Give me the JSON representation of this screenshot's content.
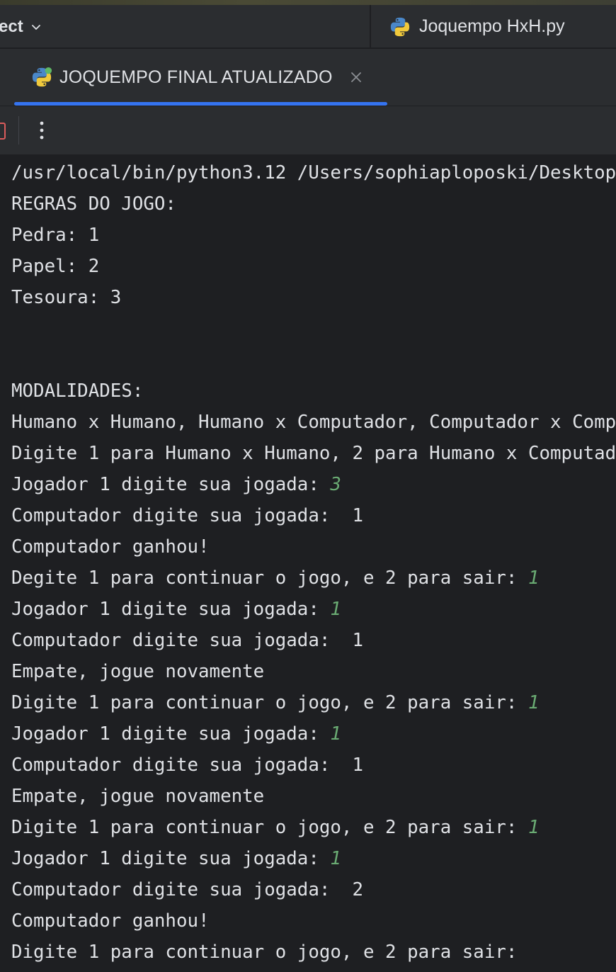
{
  "header": {
    "project_label": "ect",
    "editor_tab": {
      "label": "Joquempo HxH.py",
      "icon": "python-icon"
    }
  },
  "run_panel": {
    "tab": {
      "label": "JOQUEMPO FINAL ATUALIZADO",
      "icon": "python-icon"
    }
  },
  "toolbar": {
    "stop_icon": "stop-icon",
    "more_icon": "more-vertical-icon"
  },
  "console": {
    "input_color": "#6aab73",
    "lines": [
      {
        "text": "/usr/local/bin/python3.12 /Users/sophiaploposki/Desktop",
        "input": ""
      },
      {
        "text": "REGRAS DO JOGO:",
        "input": ""
      },
      {
        "text": "Pedra: 1",
        "input": ""
      },
      {
        "text": "Papel: 2",
        "input": ""
      },
      {
        "text": "Tesoura: 3",
        "input": ""
      },
      {
        "text": "",
        "input": ""
      },
      {
        "text": "",
        "input": ""
      },
      {
        "text": "MODALIDADES:",
        "input": ""
      },
      {
        "text": "Humano x Humano, Humano x Computador, Computador x Comp",
        "input": ""
      },
      {
        "text": "Digite 1 para Humano x Humano, 2 para Humano x Computad",
        "input": ""
      },
      {
        "text": "Jogador 1 digite sua jogada: ",
        "input": "3"
      },
      {
        "text": "Computador digite sua jogada:  1",
        "input": ""
      },
      {
        "text": "Computador ganhou!",
        "input": ""
      },
      {
        "text": "Degite 1 para continuar o jogo, e 2 para sair: ",
        "input": "1"
      },
      {
        "text": "Jogador 1 digite sua jogada: ",
        "input": "1"
      },
      {
        "text": "Computador digite sua jogada:  1",
        "input": ""
      },
      {
        "text": "Empate, jogue novamente",
        "input": ""
      },
      {
        "text": "Digite 1 para continuar o jogo, e 2 para sair: ",
        "input": "1"
      },
      {
        "text": "Jogador 1 digite sua jogada: ",
        "input": "1"
      },
      {
        "text": "Computador digite sua jogada:  1",
        "input": ""
      },
      {
        "text": "Empate, jogue novamente",
        "input": ""
      },
      {
        "text": "Digite 1 para continuar o jogo, e 2 para sair: ",
        "input": "1"
      },
      {
        "text": "Jogador 1 digite sua jogada: ",
        "input": "1"
      },
      {
        "text": "Computador digite sua jogada:  2",
        "input": ""
      },
      {
        "text": "Computador ganhou!",
        "input": ""
      },
      {
        "text": "Digite 1 para continuar o jogo, e 2 para sair:",
        "input": ""
      }
    ]
  }
}
